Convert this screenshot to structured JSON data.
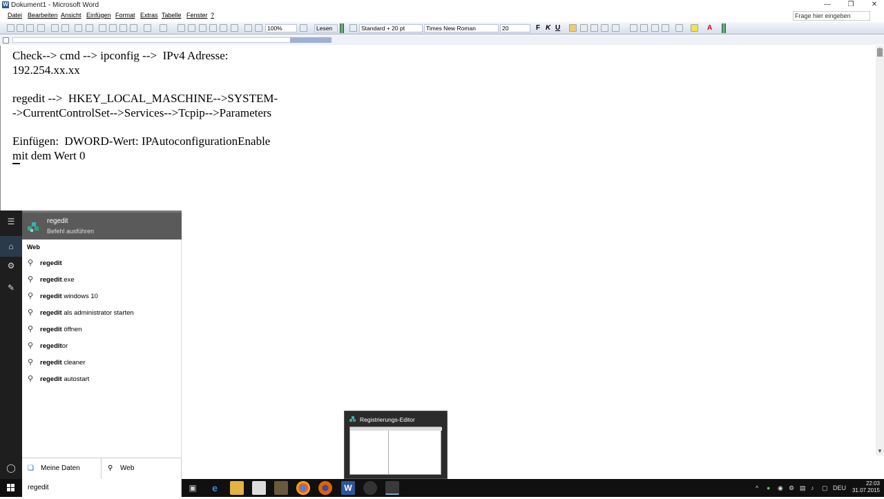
{
  "window": {
    "title": "Dokument1 - Microsoft Word",
    "ask_placeholder": "Frage hier eingeben"
  },
  "menu": [
    "Datei",
    "Bearbeiten",
    "Ansicht",
    "Einfügen",
    "Format",
    "Extras",
    "Tabelle",
    "Fenster",
    "?"
  ],
  "toolbar": {
    "zoom": "100%",
    "read_label": "Lesen",
    "style": "Standard + 20 pt",
    "font": "Times New Roman",
    "size": "20"
  },
  "document": {
    "lines": [
      "Check--> cmd --> ipconfig -->  IPv4 Adresse:",
      "192.254.xx.xx",
      "",
      "regedit -->  HKEY_LOCAL_MASCHINE-->SYSTEM-",
      "->CurrentControlSet-->Services-->Tcpip-->Parameters",
      "",
      "Einfügen:  DWORD-Wert: IPAutoconfigurationEnable",
      "mit dem Wert 0"
    ]
  },
  "search_panel": {
    "best_match": {
      "name": "regedit",
      "subtitle": "Befehl ausführen",
      "icon": "registry-icon"
    },
    "section_heading": "Web",
    "results": [
      {
        "bold": "regedit",
        "rest": ""
      },
      {
        "bold": "regedit",
        "rest": ".exe"
      },
      {
        "bold": "regedit",
        "rest": " windows 10"
      },
      {
        "bold": "regedit",
        "rest": " als administrator starten"
      },
      {
        "bold": "regedit",
        "rest": " öffnen"
      },
      {
        "bold": "regedit",
        "rest": "or"
      },
      {
        "bold": "regedit",
        "rest": " cleaner"
      },
      {
        "bold": "regedit",
        "rest": " autostart"
      }
    ],
    "filter_my_stuff": "Meine Daten",
    "filter_web": "Web",
    "query": "regedit"
  },
  "taskbar": {
    "thumbnail_title": "Registrierungs-Editor",
    "language": "DEU",
    "time": "22:03",
    "date": "31.07.2015",
    "apps": [
      "task-view-icon",
      "edge-icon",
      "explorer-icon",
      "store-icon",
      "media-icon",
      "chrome-icon",
      "firefox-icon",
      "word-icon",
      "app-icon",
      "regedit-icon"
    ]
  }
}
